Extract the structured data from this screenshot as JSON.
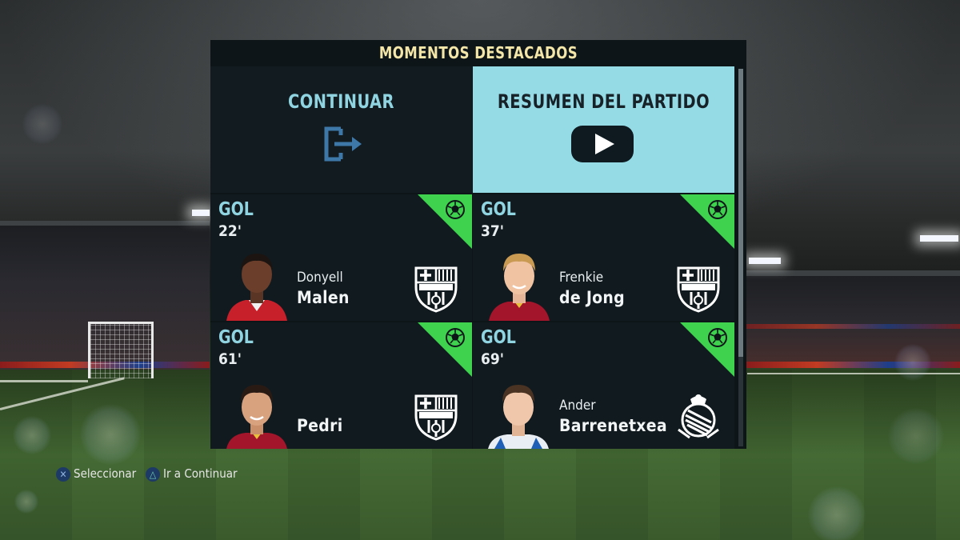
{
  "screen": {
    "title": "MOMENTOS DESTACADOS",
    "accent_color": "#95dbe6",
    "goal_corner_color": "#3ed24e"
  },
  "actions": {
    "continue_label": "CONTINUAR",
    "summary_label": "RESUMEN DEL PARTIDO"
  },
  "highlights": [
    {
      "type": "GOL",
      "minute": "22'",
      "first_name": "Donyell",
      "last_name": "Malen",
      "club_crest": "fc-barcelona-crest",
      "kit": "red-white"
    },
    {
      "type": "GOL",
      "minute": "37'",
      "first_name": "Frenkie",
      "last_name": "de Jong",
      "club_crest": "fc-barcelona-crest",
      "kit": "red-yellow"
    },
    {
      "type": "GOL",
      "minute": "61'",
      "first_name": "",
      "last_name": "Pedri",
      "club_crest": "fc-barcelona-crest",
      "kit": "red-yellow"
    },
    {
      "type": "GOL",
      "minute": "69'",
      "first_name": "Ander",
      "last_name": "Barrenetxea",
      "club_crest": "real-sociedad-crest",
      "kit": "blue-white"
    }
  ],
  "footer": {
    "select_label": "Seleccionar",
    "select_button": "cross-button-icon",
    "continue_hint_label": "Ir a Continuar",
    "continue_hint_button": "triangle-button-icon"
  }
}
